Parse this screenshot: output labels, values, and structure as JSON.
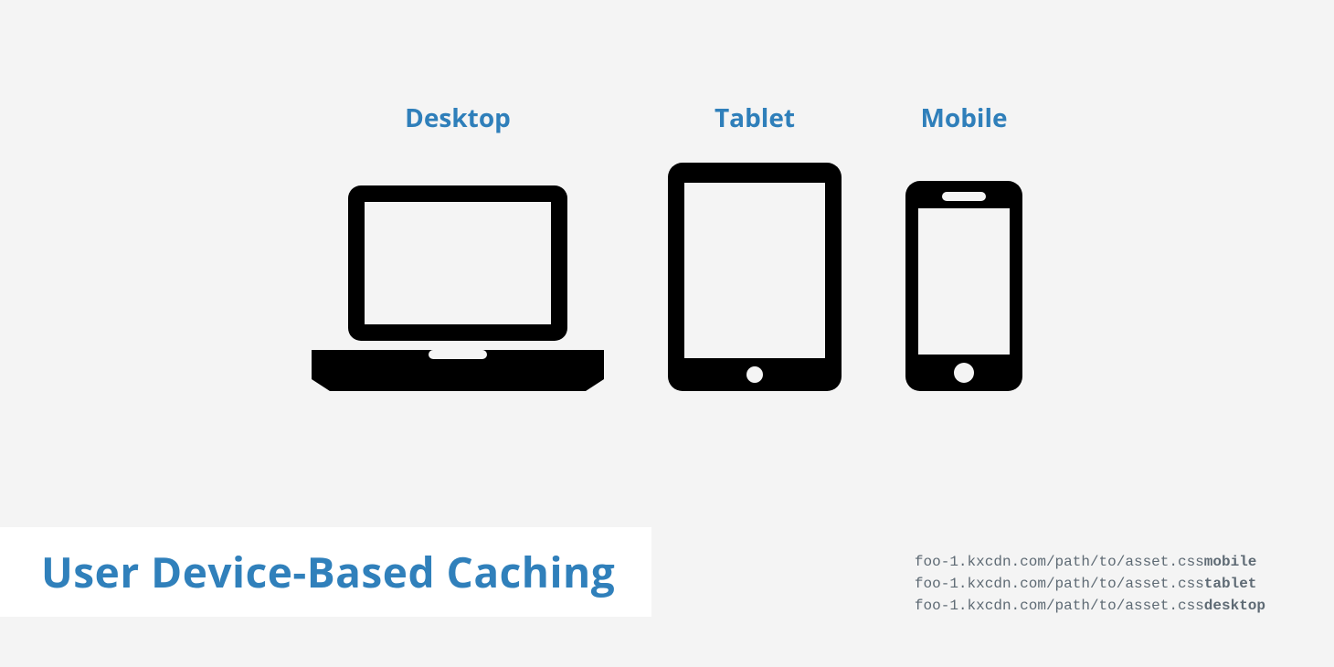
{
  "title": "User Device-Based Caching",
  "devices": [
    {
      "label": "Desktop"
    },
    {
      "label": "Tablet"
    },
    {
      "label": "Mobile"
    }
  ],
  "asset_base": "foo-1.kxcdn.com/path/to/asset.css",
  "asset_suffixes": [
    "mobile",
    "tablet",
    "desktop"
  ],
  "colors": {
    "heading": "#3080bb",
    "label": "#2f7fba",
    "icon": "#000000",
    "bg": "#f4f4f4",
    "code": "#5e6a74"
  }
}
